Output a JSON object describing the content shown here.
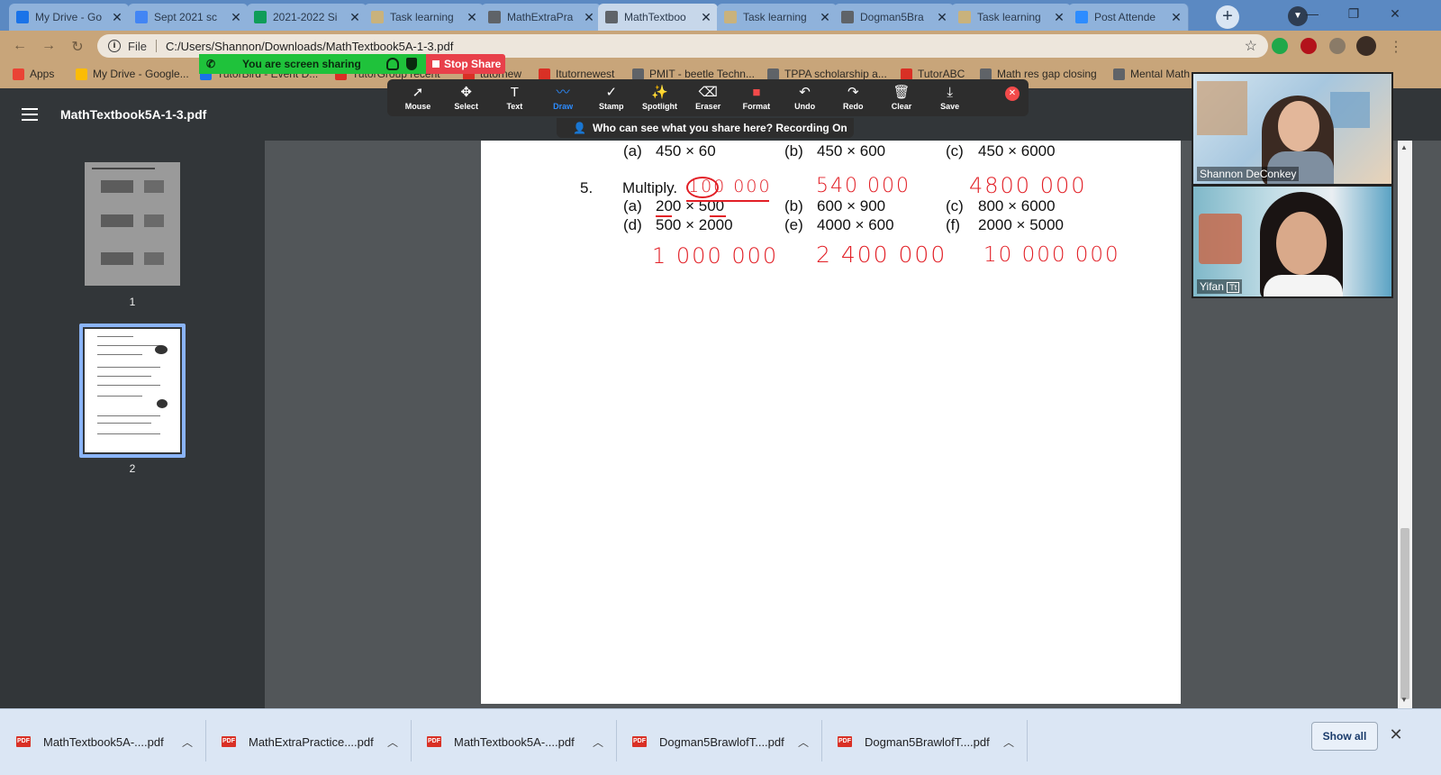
{
  "tabs": [
    {
      "title": "My Drive - Go",
      "icon": "google-drive-icon",
      "color": "#1a73e8"
    },
    {
      "title": "Sept 2021 sc",
      "icon": "google-docs-icon",
      "color": "#4285f4"
    },
    {
      "title": "2021-2022 Si",
      "icon": "google-sheets-icon",
      "color": "#0f9d58"
    },
    {
      "title": "Task learning",
      "icon": "page-icon",
      "color": "#c9b27c"
    },
    {
      "title": "MathExtraPra",
      "icon": "globe-icon",
      "color": "#5f6368"
    },
    {
      "title": "MathTextboo",
      "icon": "globe-icon",
      "color": "#5f6368"
    },
    {
      "title": "Task learning",
      "icon": "page-icon",
      "color": "#c9b27c"
    },
    {
      "title": "Dogman5Bra",
      "icon": "globe-icon",
      "color": "#5f6368"
    },
    {
      "title": "Task learning",
      "icon": "page-icon",
      "color": "#c9b27c"
    },
    {
      "title": "Post Attende",
      "icon": "zoom-icon",
      "color": "#2d8cff"
    }
  ],
  "address": {
    "scheme": "File",
    "url": "C:/Users/Shannon/Downloads/MathTextbook5A-1-3.pdf"
  },
  "bookmarks": [
    {
      "label": "Apps",
      "color": "#ea4335"
    },
    {
      "label": "My Drive - Google...",
      "color": "#fbbc04"
    },
    {
      "label": "TutorBird - Event D...",
      "color": "#1a73e8"
    },
    {
      "label": "TutorGroup recent",
      "color": "#d93025"
    },
    {
      "label": "tutornew",
      "color": "#d93025"
    },
    {
      "label": "Itutornewest",
      "color": "#d93025"
    },
    {
      "label": "PMIT - beetle Techn...",
      "color": "#5f6368"
    },
    {
      "label": "TPPA scholarship a...",
      "color": "#5f6368"
    },
    {
      "label": "TutorABC",
      "color": "#d93025"
    },
    {
      "label": "Math res gap closing",
      "color": "#5f6368"
    },
    {
      "label": "Mental Math",
      "color": "#5f6368"
    }
  ],
  "sharing": {
    "banner": "You are screen sharing",
    "stop": "Stop Share"
  },
  "annotate": {
    "tools": [
      {
        "label": "Mouse",
        "glyph": "➚",
        "icon": "mouse-pointer-icon"
      },
      {
        "label": "Select",
        "glyph": "✥",
        "icon": "move-icon"
      },
      {
        "label": "Text",
        "glyph": "T",
        "icon": "text-icon"
      },
      {
        "label": "Draw",
        "glyph": "〰",
        "icon": "draw-icon"
      },
      {
        "label": "Stamp",
        "glyph": "✓",
        "icon": "stamp-icon"
      },
      {
        "label": "Spotlight",
        "glyph": "✨",
        "icon": "spotlight-icon"
      },
      {
        "label": "Eraser",
        "glyph": "⌫",
        "icon": "eraser-icon"
      },
      {
        "label": "Format",
        "glyph": "■",
        "icon": "format-icon"
      },
      {
        "label": "Undo",
        "glyph": "↶",
        "icon": "undo-icon"
      },
      {
        "label": "Redo",
        "glyph": "↷",
        "icon": "redo-icon"
      },
      {
        "label": "Clear",
        "glyph": "🗑",
        "icon": "trash-icon"
      },
      {
        "label": "Save",
        "glyph": "⤓",
        "icon": "save-icon"
      }
    ],
    "active": "Draw",
    "notice": "Who can see what you share here? Recording On"
  },
  "pdf": {
    "title": "MathTextbook5A-1-3.pdf",
    "thumbnails": [
      "1",
      "2"
    ]
  },
  "worksheet": {
    "row_top": [
      {
        "letter": "(a)",
        "expr": "450 × 60"
      },
      {
        "letter": "(b)",
        "expr": "450 × 600"
      },
      {
        "letter": "(c)",
        "expr": "450 × 6000"
      }
    ],
    "q5_number": "5.",
    "q5_title": "Multiply.",
    "row1": [
      {
        "letter": "(a)",
        "expr": "200 × 500"
      },
      {
        "letter": "(b)",
        "expr": "600 × 900"
      },
      {
        "letter": "(c)",
        "expr": "800 × 6000"
      }
    ],
    "row2": [
      {
        "letter": "(d)",
        "expr": "500 × 2000"
      },
      {
        "letter": "(e)",
        "expr": "4000 × 600"
      },
      {
        "letter": "(f)",
        "expr": "2000 × 5000"
      }
    ],
    "handwritten_top": [
      "100 000",
      "540 000",
      "4800 000"
    ],
    "handwritten_bottom": [
      "1 000 000",
      "2 400 000",
      "10 000 000"
    ],
    "ink_color": "#e21f26"
  },
  "participants": [
    {
      "name": "Shannon DeConkey"
    },
    {
      "name": "Yifan"
    }
  ],
  "downloads": [
    {
      "name": "MathTextbook5A-....pdf"
    },
    {
      "name": "MathExtraPractice....pdf"
    },
    {
      "name": "MathTextbook5A-....pdf"
    },
    {
      "name": "Dogman5BrawlofT....pdf"
    },
    {
      "name": "Dogman5BrawlofT....pdf"
    }
  ],
  "shelf": {
    "show_all": "Show all"
  }
}
